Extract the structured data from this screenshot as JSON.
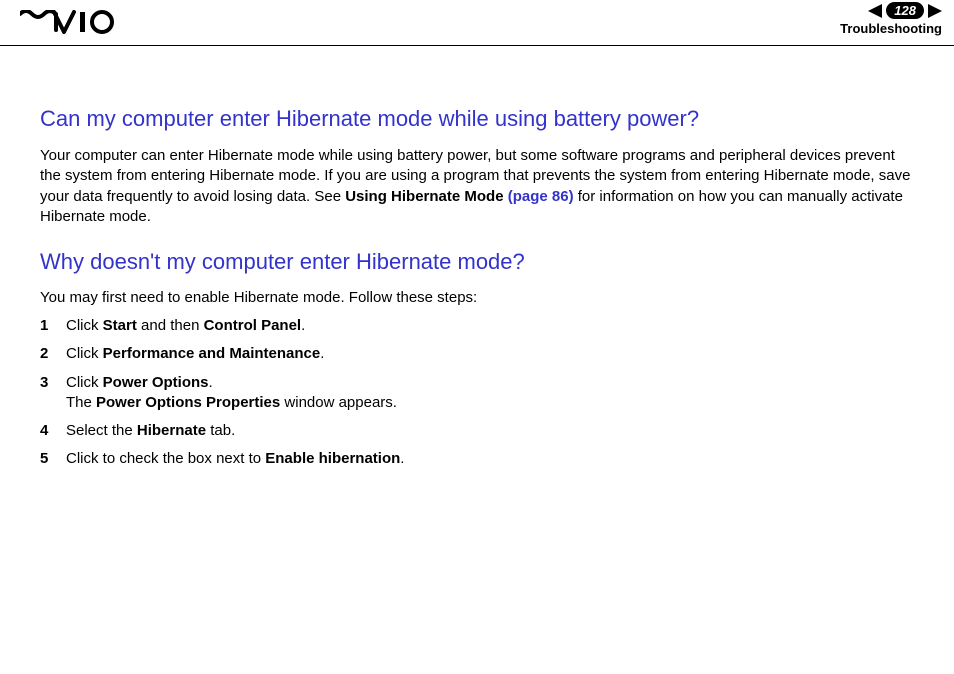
{
  "header": {
    "page_number": "128",
    "section": "Troubleshooting"
  },
  "section1": {
    "heading": "Can my computer enter Hibernate mode while using battery power?",
    "para_pre": "Your computer can enter Hibernate mode while using battery power, but some software programs and peripheral devices prevent the system from entering Hibernate mode. If you are using a program that prevents the system from entering Hibernate mode, save your data frequently to avoid losing data. See ",
    "para_bold": "Using Hibernate Mode ",
    "para_link": "(page 86)",
    "para_post": " for information on how you can manually activate Hibernate mode."
  },
  "section2": {
    "heading": "Why doesn't my computer enter Hibernate mode?",
    "intro": "You may first need to enable Hibernate mode. Follow these steps:",
    "steps": [
      {
        "num": "1",
        "pre": "Click ",
        "b1": "Start",
        "mid": " and then ",
        "b2": "Control Panel",
        "post": "."
      },
      {
        "num": "2",
        "pre": "Click ",
        "b1": "Performance and Maintenance",
        "mid": "",
        "b2": "",
        "post": "."
      },
      {
        "num": "3",
        "line1_pre": "Click ",
        "line1_b": "Power Options",
        "line1_post": ".",
        "line2_pre": "The ",
        "line2_b": "Power Options Properties",
        "line2_post": " window appears."
      },
      {
        "num": "4",
        "pre": "Select the ",
        "b1": "Hibernate",
        "mid": "",
        "b2": "",
        "post": " tab."
      },
      {
        "num": "5",
        "pre": "Click to check the box next to ",
        "b1": "Enable hibernation",
        "mid": "",
        "b2": "",
        "post": "."
      }
    ]
  }
}
